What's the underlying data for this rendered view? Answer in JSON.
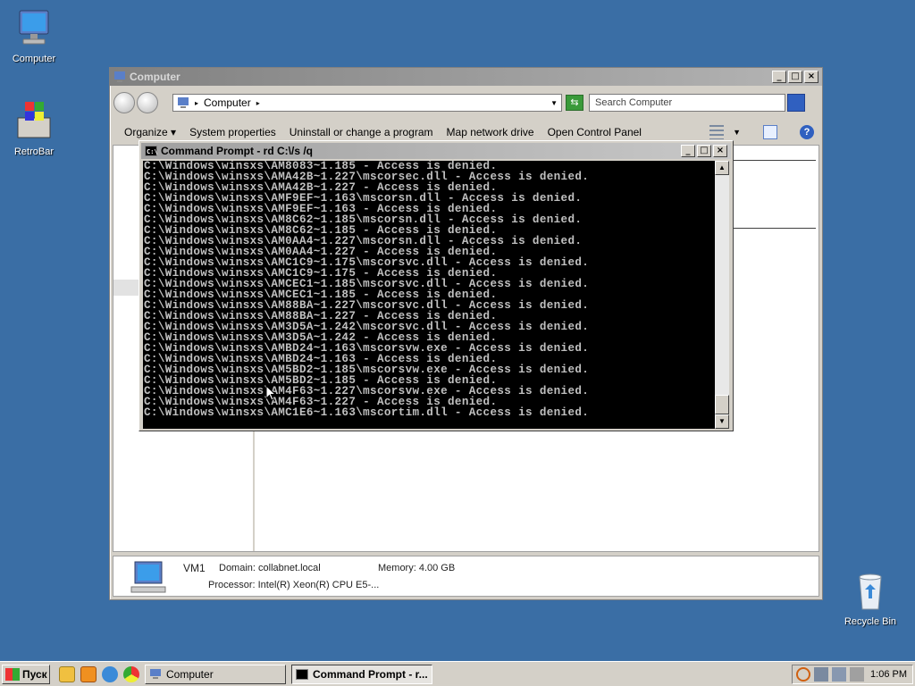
{
  "desktop": {
    "icons": [
      {
        "label": "Computer"
      },
      {
        "label": "RetroBar"
      },
      {
        "label": "Recycle Bin"
      }
    ]
  },
  "explorer": {
    "title": "Computer",
    "address": "Computer",
    "search_placeholder": "Search Computer",
    "toolbar": {
      "organize": "Organize",
      "system_properties": "System properties",
      "uninstall": "Uninstall or change a program",
      "map_drive": "Map network drive",
      "control_panel": "Open Control Panel"
    },
    "details": {
      "name": "VM1",
      "domain": "Domain: collabnet.local",
      "memory": "Memory: 4.00 GB",
      "processor": "Processor: Intel(R) Xeon(R) CPU E5-..."
    }
  },
  "cmd": {
    "title": "Command Prompt - rd  C:\\/s /q",
    "lines": [
      "C:\\Windows\\winsxs\\AM8083~1.185 - Access is denied.",
      "C:\\Windows\\winsxs\\AMA42B~1.227\\mscorsec.dll - Access is denied.",
      "C:\\Windows\\winsxs\\AMA42B~1.227 - Access is denied.",
      "C:\\Windows\\winsxs\\AMF9EF~1.163\\mscorsn.dll - Access is denied.",
      "C:\\Windows\\winsxs\\AMF9EF~1.163 - Access is denied.",
      "C:\\Windows\\winsxs\\AM8C62~1.185\\mscorsn.dll - Access is denied.",
      "C:\\Windows\\winsxs\\AM8C62~1.185 - Access is denied.",
      "C:\\Windows\\winsxs\\AM0AA4~1.227\\mscorsn.dll - Access is denied.",
      "C:\\Windows\\winsxs\\AM0AA4~1.227 - Access is denied.",
      "C:\\Windows\\winsxs\\AMC1C9~1.175\\mscorsvc.dll - Access is denied.",
      "C:\\Windows\\winsxs\\AMC1C9~1.175 - Access is denied.",
      "C:\\Windows\\winsxs\\AMCEC1~1.185\\mscorsvc.dll - Access is denied.",
      "C:\\Windows\\winsxs\\AMCEC1~1.185 - Access is denied.",
      "C:\\Windows\\winsxs\\AM88BA~1.227\\mscorsvc.dll - Access is denied.",
      "C:\\Windows\\winsxs\\AM88BA~1.227 - Access is denied.",
      "C:\\Windows\\winsxs\\AM3D5A~1.242\\mscorsvc.dll - Access is denied.",
      "C:\\Windows\\winsxs\\AM3D5A~1.242 - Access is denied.",
      "C:\\Windows\\winsxs\\AMBD24~1.163\\mscorsvw.exe - Access is denied.",
      "C:\\Windows\\winsxs\\AMBD24~1.163 - Access is denied.",
      "C:\\Windows\\winsxs\\AM5BD2~1.185\\mscorsvw.exe - Access is denied.",
      "C:\\Windows\\winsxs\\AM5BD2~1.185 - Access is denied.",
      "C:\\Windows\\winsxs\\AM4F63~1.227\\mscorsvw.exe - Access is denied.",
      "C:\\Windows\\winsxs\\AM4F63~1.227 - Access is denied.",
      "C:\\Windows\\winsxs\\AMC1E6~1.163\\mscortim.dll - Access is denied."
    ]
  },
  "taskbar": {
    "start_label": "Пуск",
    "tasks": [
      {
        "label": "Computer"
      },
      {
        "label": "Command Prompt - r..."
      }
    ],
    "clock": "1:06 PM"
  }
}
